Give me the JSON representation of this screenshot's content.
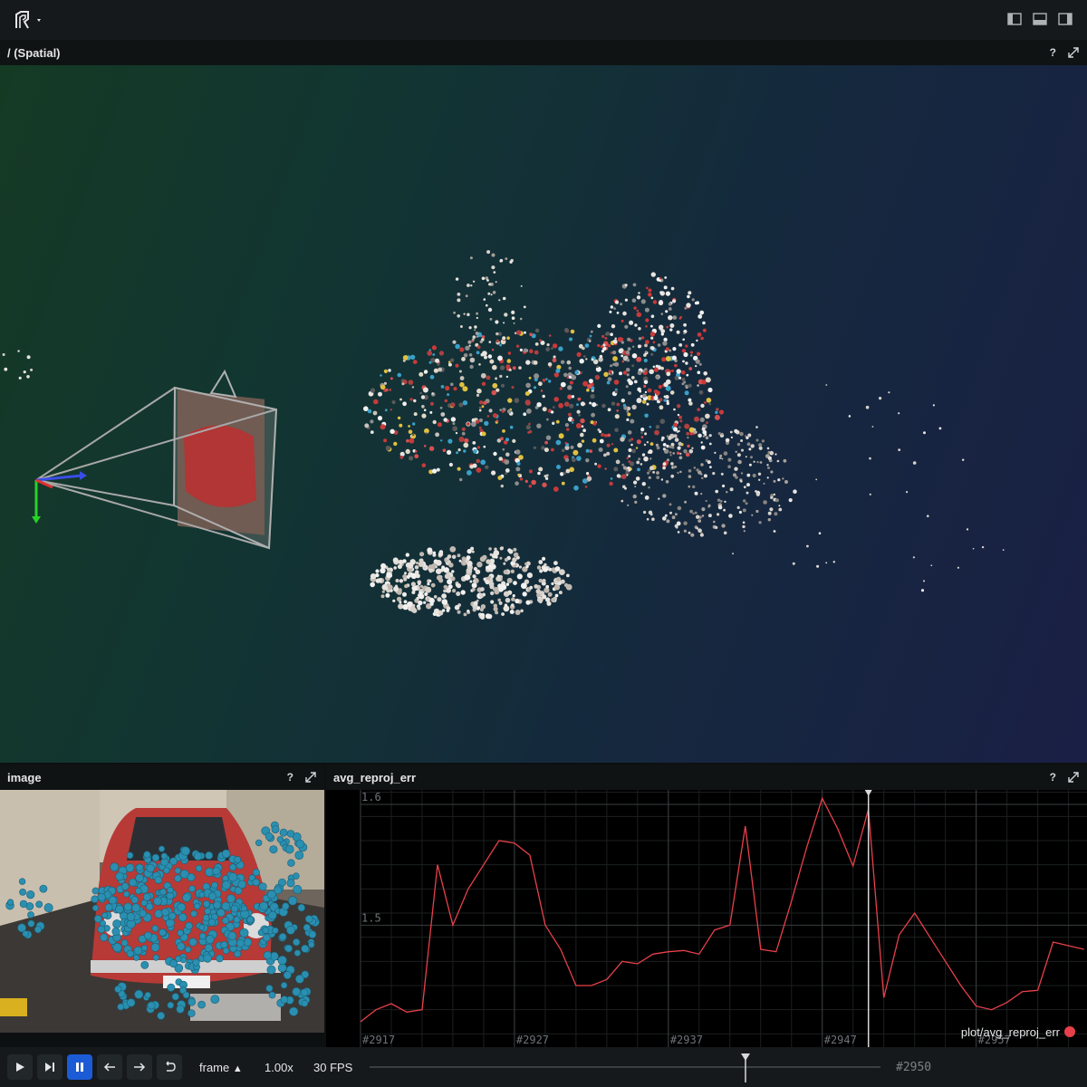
{
  "app": {
    "logo_icon": "rerun-logo-icon",
    "menu_icon": "caret-down-icon",
    "layout_icons": [
      "left-panel-icon",
      "bottom-panel-icon",
      "right-panel-icon"
    ]
  },
  "spatial": {
    "title": "/ (Spatial)",
    "help": "?",
    "maximize_icon": "expand-icon"
  },
  "image": {
    "title": "image",
    "help": "?",
    "maximize_icon": "expand-icon"
  },
  "plot": {
    "title": "avg_reproj_err",
    "help": "?",
    "maximize_icon": "expand-icon",
    "legend": "plot/avg_reproj_err",
    "legend_color": "#e8404a"
  },
  "chart_data": {
    "type": "line",
    "xlabel": "",
    "ylabel": "",
    "x_tick_labels": [
      "#2917",
      "#2927",
      "#2937",
      "#2947",
      "#2957"
    ],
    "x_ticks": [
      2917,
      2927,
      2937,
      2947,
      2957
    ],
    "y_tick_labels": [
      "1.6",
      "1.5"
    ],
    "y_ticks": [
      1.6,
      1.5
    ],
    "xlim": [
      2917,
      2964.2
    ],
    "ylim": [
      1.405,
      1.612
    ],
    "grid": true,
    "time_cursor": 2950,
    "series": [
      {
        "name": "plot/avg_reproj_err",
        "color": "#e8404a",
        "x": [
          2917,
          2918,
          2919,
          2920,
          2921,
          2922,
          2923,
          2924,
          2925,
          2926,
          2927,
          2928,
          2929,
          2930,
          2931,
          2932,
          2933,
          2934,
          2935,
          2936,
          2937,
          2938,
          2939,
          2940,
          2941,
          2942,
          2943,
          2944,
          2945,
          2946,
          2947,
          2948,
          2949,
          2950,
          2951,
          2952,
          2953,
          2954,
          2955,
          2956,
          2957,
          2958,
          2959,
          2960,
          2961,
          2962,
          2963,
          2964
        ],
        "y": [
          1.42,
          1.43,
          1.435,
          1.428,
          1.43,
          1.55,
          1.5,
          1.53,
          1.55,
          1.57,
          1.568,
          1.558,
          1.5,
          1.48,
          1.45,
          1.45,
          1.455,
          1.47,
          1.468,
          1.476,
          1.478,
          1.479,
          1.476,
          1.496,
          1.5,
          1.582,
          1.48,
          1.478,
          1.52,
          1.565,
          1.605,
          1.58,
          1.549,
          1.596,
          1.44,
          1.492,
          1.51,
          1.49,
          1.47,
          1.45,
          1.433,
          1.43,
          1.436,
          1.445,
          1.446,
          1.486,
          1.483,
          1.48
        ]
      }
    ]
  },
  "timebar": {
    "play_icon": "play-icon",
    "step_end_icon": "skip-to-end-icon",
    "pause_icon": "pause-icon",
    "step_back_icon": "arrow-left-icon",
    "step_forward_icon": "arrow-right-icon",
    "loop_icon": "loop-icon",
    "timeline": "frame",
    "timeline_caret": "▲",
    "speed": "1.00x",
    "fps": "30 FPS",
    "current_time": "#2950",
    "playhead_fraction": 0.735
  }
}
